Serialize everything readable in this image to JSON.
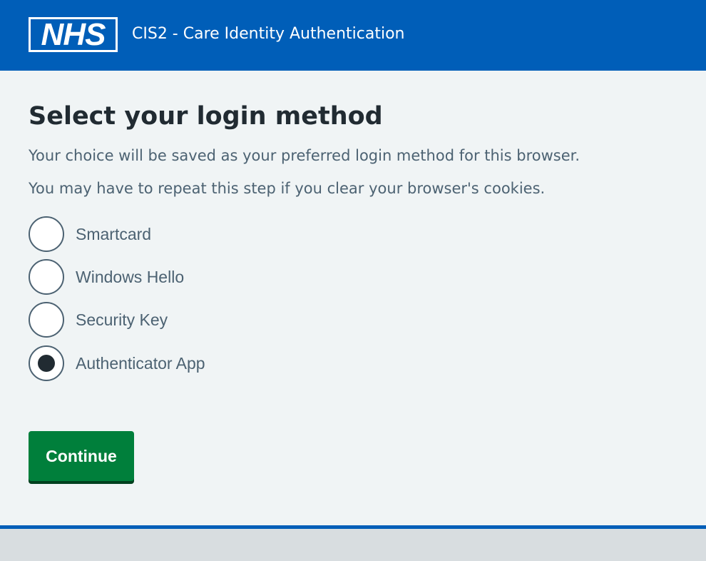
{
  "header": {
    "logo_text": "NHS",
    "service_name": "CIS2 - Care Identity Authentication",
    "colors": {
      "background": "#005eb8",
      "text": "#ffffff"
    }
  },
  "main": {
    "title": "Select your login method",
    "hints": [
      "Your choice will be saved as your preferred login method for this browser.",
      "You may have to repeat this step if you clear your browser's cookies."
    ],
    "options": [
      {
        "label": "Smartcard",
        "selected": false
      },
      {
        "label": "Windows Hello",
        "selected": false
      },
      {
        "label": "Security Key",
        "selected": false
      },
      {
        "label": "Authenticator App",
        "selected": true
      }
    ],
    "continue_label": "Continue"
  },
  "colors": {
    "page_background": "#f0f4f5",
    "primary_button": "#007f3b",
    "footer_rule": "#005eb8",
    "footer_background": "#d8dde0"
  }
}
